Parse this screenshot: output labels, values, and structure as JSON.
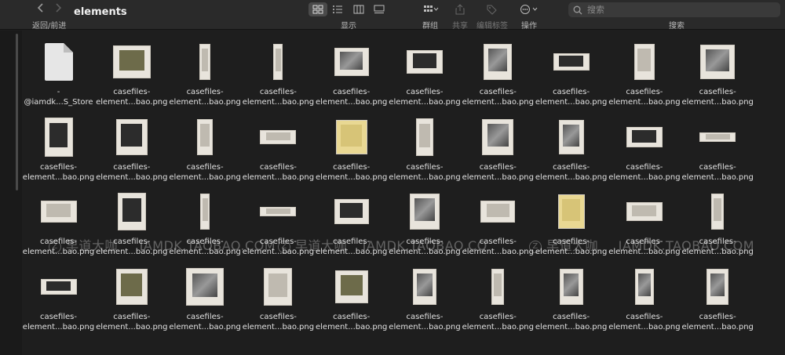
{
  "toolbar": {
    "back_forward_label": "返回/前进",
    "title": "elements",
    "view_label": "显示",
    "group_label": "群组",
    "share_label": "共享",
    "tags_label": "编辑标签",
    "action_label": "操作",
    "search_label": "搜索",
    "search_placeholder": "搜索",
    "view_mode_active": "icon"
  },
  "watermark": {
    "brand": "早道大咖",
    "site": "IAMDK.TAOBAO.COM",
    "site_partial": "IAMDK.TAOBAO.CO"
  },
  "files": [
    {
      "line1": "-",
      "line2": "@iamdk...S_Store",
      "kind": "doc"
    },
    {
      "line1": "casefiles-",
      "line2": "element...bao.png",
      "kind": "olive"
    },
    {
      "line1": "casefiles-",
      "line2": "element...bao.png",
      "kind": "light"
    },
    {
      "line1": "casefiles-",
      "line2": "element...bao.png",
      "kind": "light"
    },
    {
      "line1": "casefiles-",
      "line2": "element...bao.png",
      "kind": "photo"
    },
    {
      "line1": "casefiles-",
      "line2": "element...bao.png",
      "kind": "dark"
    },
    {
      "line1": "casefiles-",
      "line2": "element...bao.png",
      "kind": "photo"
    },
    {
      "line1": "casefiles-",
      "line2": "element...bao.png",
      "kind": "dark"
    },
    {
      "line1": "casefiles-",
      "line2": "element...bao.png",
      "kind": "light"
    },
    {
      "line1": "casefiles-",
      "line2": "element...bao.png",
      "kind": "photo"
    },
    {
      "line1": "casefiles-",
      "line2": "element...bao.png",
      "kind": "dark"
    },
    {
      "line1": "casefiles-",
      "line2": "element...bao.png",
      "kind": "dark"
    },
    {
      "line1": "casefiles-",
      "line2": "element...bao.png",
      "kind": "light"
    },
    {
      "line1": "casefiles-",
      "line2": "element...bao.png",
      "kind": "light"
    },
    {
      "line1": "casefiles-",
      "line2": "element...bao.png",
      "kind": "yellow"
    },
    {
      "line1": "casefiles-",
      "line2": "element...bao.png",
      "kind": "light"
    },
    {
      "line1": "casefiles-",
      "line2": "element...bao.png",
      "kind": "photo"
    },
    {
      "line1": "casefiles-",
      "line2": "element...bao.png",
      "kind": "photo"
    },
    {
      "line1": "casefiles-",
      "line2": "element...bao.png",
      "kind": "dark"
    },
    {
      "line1": "casefiles-",
      "line2": "element...bao.png",
      "kind": "light"
    },
    {
      "line1": "casefiles-",
      "line2": "element...bao.png",
      "kind": "light"
    },
    {
      "line1": "casefiles-",
      "line2": "element...bao.png",
      "kind": "dark"
    },
    {
      "line1": "casefiles-",
      "line2": "element...bao.png",
      "kind": "light"
    },
    {
      "line1": "casefiles-",
      "line2": "element...bao.png",
      "kind": "light"
    },
    {
      "line1": "casefiles-",
      "line2": "element...bao.png",
      "kind": "dark"
    },
    {
      "line1": "casefiles-",
      "line2": "element...bao.png",
      "kind": "photo"
    },
    {
      "line1": "casefiles-",
      "line2": "element...bao.png",
      "kind": "light"
    },
    {
      "line1": "casefiles-",
      "line2": "element...bao.png",
      "kind": "yellow"
    },
    {
      "line1": "casefiles-",
      "line2": "element...bao.png",
      "kind": "light"
    },
    {
      "line1": "casefiles-",
      "line2": "element...bao.png",
      "kind": "light"
    },
    {
      "line1": "casefiles-",
      "line2": "element...bao.png",
      "kind": "dark"
    },
    {
      "line1": "casefiles-",
      "line2": "element...bao.png",
      "kind": "olive"
    },
    {
      "line1": "casefiles-",
      "line2": "element...bao.png",
      "kind": "photo"
    },
    {
      "line1": "casefiles-",
      "line2": "element...bao.png",
      "kind": "light"
    },
    {
      "line1": "casefiles-",
      "line2": "element...bao.png",
      "kind": "olive"
    },
    {
      "line1": "casefiles-",
      "line2": "element...bao.png",
      "kind": "photo"
    },
    {
      "line1": "casefiles-",
      "line2": "element...bao.png",
      "kind": "light"
    },
    {
      "line1": "casefiles-",
      "line2": "element...bao.png",
      "kind": "photo"
    },
    {
      "line1": "casefiles-",
      "line2": "element...bao.png",
      "kind": "photo"
    },
    {
      "line1": "casefiles-",
      "line2": "element...bao.png",
      "kind": "photo"
    }
  ]
}
